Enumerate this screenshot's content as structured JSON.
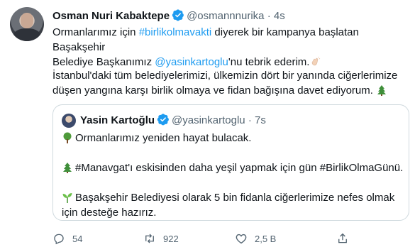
{
  "tweet": {
    "author_name": "Osman Nuri Kabaktepe",
    "author_handle": "@osmannnurika",
    "separator": "·",
    "time": "4s",
    "p1_a": "Ormanlarımız için ",
    "p1_hashtag": "#birlikolmavakti",
    "p1_b": " diyerek bir kampanya başlatan Başakşehir",
    "p1_c": "Belediye Başkanımız ",
    "p1_mention": "@yasinkartoglu",
    "p1_d": "'nu tebrik ederim.",
    "p2_line1": "İstanbul'daki tüm belediyelerimizi, ülkemizin dört bir yanında ciğerlerimize",
    "p2_line2": "düşen yangına karşı birlik olmaya ve fidan bağışına davet ediyorum."
  },
  "quoted": {
    "author_name": "Yasin Kartoğlu",
    "author_handle": "@yasinkartoglu",
    "separator": "·",
    "time": "7s",
    "line1": "Ormanlarımız yeniden hayat bulacak.",
    "line2": "#Manavgat'ı eskisinden daha yeşil yapmak için gün #BirlikOlmaGünü.",
    "line3": "Başakşehir Belediyesi olarak 5 bin fidanla ciğerlerimize nefes olmak",
    "line4": "için desteğe hazırız."
  },
  "actions": {
    "reply_count": "54",
    "retweet_count": "922",
    "like_count": "2,5 B",
    "icons": [
      "reply-icon",
      "retweet-icon",
      "like-icon",
      "share-icon"
    ]
  },
  "colors": {
    "accent": "#1d9bf0",
    "text": "#0f1419",
    "muted": "#536471",
    "border": "#cfd9de"
  }
}
